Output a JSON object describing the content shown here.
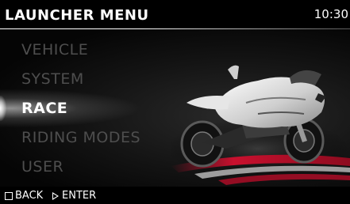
{
  "header": {
    "title": "LAUNCHER MENU",
    "clock": "10:30"
  },
  "menu": {
    "items": [
      {
        "label": "VEHICLE",
        "selected": false
      },
      {
        "label": "SYSTEM",
        "selected": false
      },
      {
        "label": "RACE",
        "selected": true
      },
      {
        "label": "RIDING MODES",
        "selected": false
      },
      {
        "label": "USER",
        "selected": false
      }
    ]
  },
  "footer": {
    "back_label": "BACK",
    "back_icon": "square-icon",
    "enter_label": "ENTER",
    "enter_icon": "triangle-right-icon"
  },
  "illustration": {
    "subject": "sport-motorcycle",
    "accent": "#c8102e"
  },
  "colors": {
    "background": "#000000",
    "selected_text": "#ffffff",
    "unselected_text": "#4e4e4e"
  }
}
